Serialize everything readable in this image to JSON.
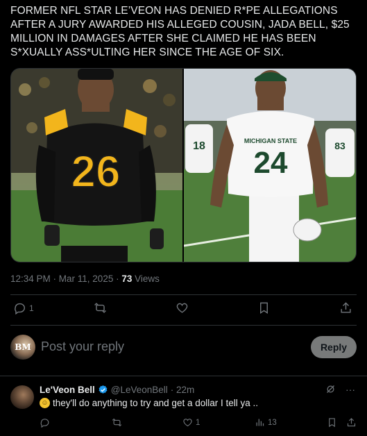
{
  "post": {
    "text": "FORMER NFL STAR LE’VEON HAS DENIED R*PE ALLEGATIONS AFTER A JURY AWARDED HIS ALLEGED COUSIN, JADA BELL, $25 MILLION IN DAMAGES AFTER SHE CLAIMED HE HAS BEEN S*XUALLY ASS*ULTING HER SINCE THE AGE OF SIX.",
    "photo_left": {
      "jersey_number": "26"
    },
    "photo_right": {
      "jersey_team": "MICHIGAN STATE",
      "jersey_number": "24",
      "bg_number_1": "18",
      "bg_number_2": "83"
    },
    "time": "12:34 PM · Mar 11, 2025",
    "views_count": "73",
    "views_label": "Views",
    "reply_count": "1",
    "repost_count": "",
    "like_count": "",
    "bookmark_count": ""
  },
  "composer": {
    "avatar_initials": "BM",
    "placeholder": "Post your reply",
    "reply_label": "Reply"
  },
  "comment": {
    "name": "Le'Veon Bell",
    "handle": "@LeVeonBell",
    "time": "· 22m",
    "text": "they'll do anything to try and get a dollar I tell ya ..",
    "like_count": "1",
    "views_count": "13",
    "more_label": "···"
  },
  "colors": {
    "background": "#000000",
    "text": "#e7e9ea",
    "muted": "#71767b",
    "divider": "#2f3336",
    "verified": "#1d9bf0",
    "reply_button": "#787a7a"
  }
}
